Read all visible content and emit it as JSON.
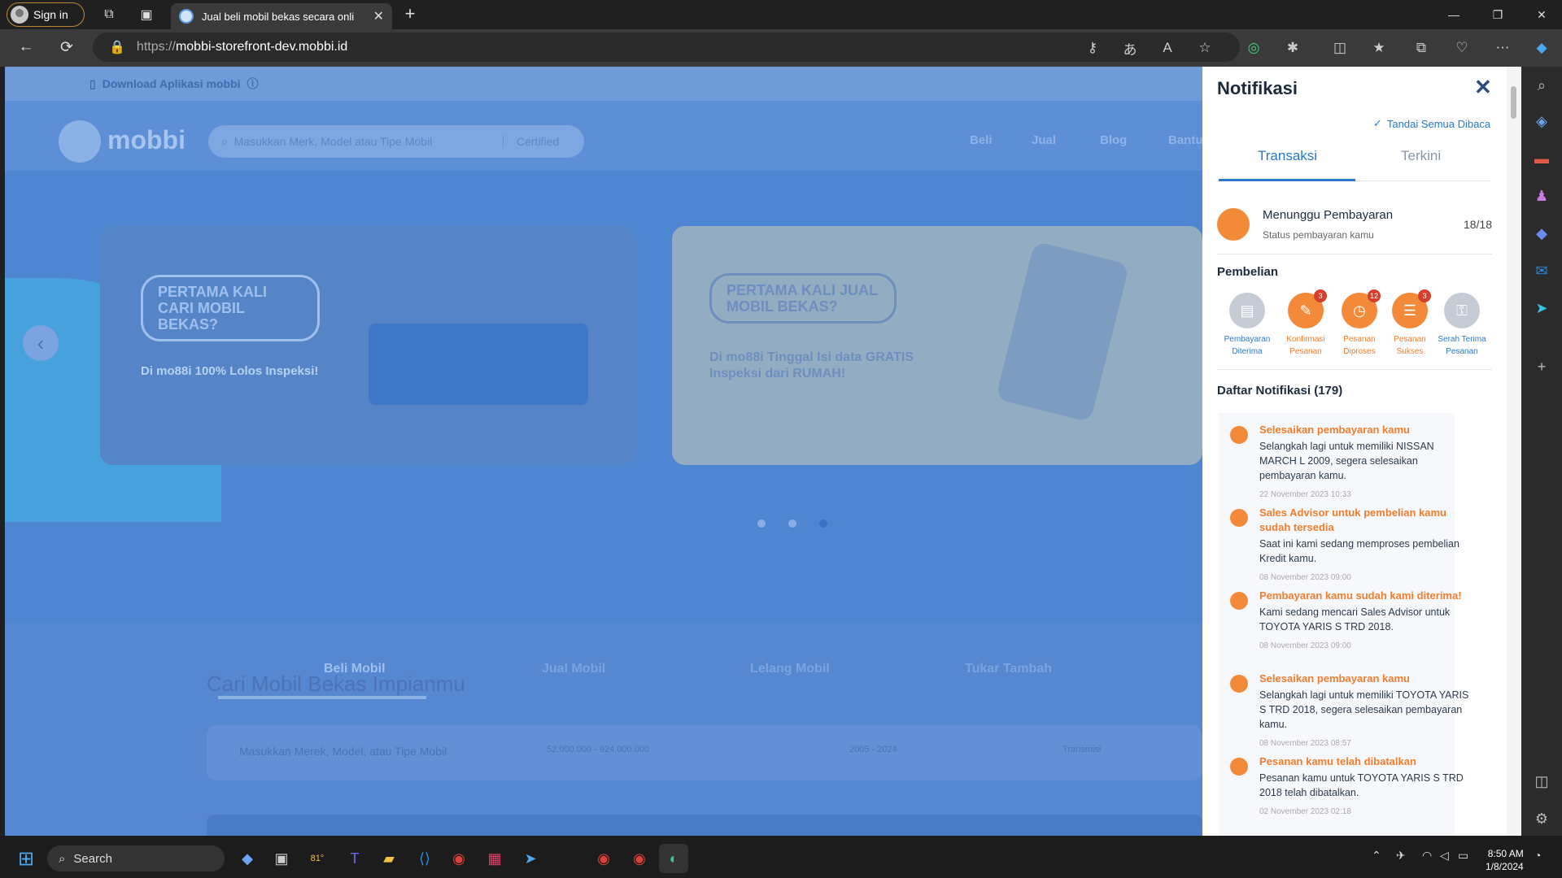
{
  "browser": {
    "signin": "Sign in",
    "tab_title": "Jual beli mobil bekas secara onli",
    "address": {
      "protocol": "https://",
      "host": "mobbi-storefront-dev.mobbi.id"
    }
  },
  "page": {
    "download_bar": "Download Aplikasi mobbi",
    "logo": "mobbi",
    "search_placeholder": "Masukkan Merk, Model atau Tipe Mobil",
    "search_filter": "Certified",
    "nav": [
      "Beli",
      "Jual",
      "Blog",
      "Bantu"
    ],
    "banner1": {
      "title": "PERTAMA KALI CARI MOBIL BEKAS?",
      "sub": "Di mo88i 100% Lolos Inspeksi!"
    },
    "banner2": {
      "title": "PERTAMA KALI JUAL MOBIL BEKAS?",
      "sub": "Di mo88i Tinggal Isi data GRATIS Inspeksi dari RUMAH!"
    },
    "tabs": [
      "Beli Mobil",
      "Jual Mobil",
      "Lelang Mobil",
      "Tukar Tambah"
    ],
    "heading": "Cari Mobil Bekas Impianmu",
    "filters": {
      "keyword": "Masukkan Merek, Model, atau Tipe Mobil",
      "price": "52.000.000 - 924.000.000",
      "year": "2005 - 2024",
      "trans": "Transmisi"
    }
  },
  "notif": {
    "title": "Notifikasi",
    "mark_all": "Tandai Semua Dibaca",
    "tabs": {
      "active": "Transaksi",
      "other": "Terkini"
    },
    "payment": {
      "title": "Menunggu Pembayaran",
      "sub": "Status pembayaran kamu",
      "count": "18/18"
    },
    "purchase_label": "Pembelian",
    "steps": [
      {
        "l1": "Pembayaran",
        "l2": "Diterima",
        "badge": ""
      },
      {
        "l1": "Konfirmasi",
        "l2": "Pesanan",
        "badge": "3"
      },
      {
        "l1": "Pesanan",
        "l2": "Diproses",
        "badge": "12"
      },
      {
        "l1": "Pesanan",
        "l2": "Sukses",
        "badge": "3"
      },
      {
        "l1": "Serah Terima",
        "l2": "Pesanan",
        "badge": ""
      }
    ],
    "list_label": "Daftar Notifikasi (179)",
    "items": [
      {
        "title": "Selesaikan pembayaran kamu",
        "desc": "Selangkah lagi untuk memiliki NISSAN MARCH L 2009, segera selesaikan pembayaran kamu.",
        "time": "22 November 2023 10:33"
      },
      {
        "title": "Sales Advisor untuk pembelian kamu sudah tersedia",
        "desc": "Saat ini kami sedang memproses pembelian Kredit kamu.",
        "time": "08 November 2023 09:00"
      },
      {
        "title": "Pembayaran kamu sudah kami diterima!",
        "desc": "Kami sedang mencari Sales Advisor untuk TOYOTA YARIS S TRD 2018.",
        "time": "08 November 2023 09:00"
      },
      {
        "title": "Selesaikan pembayaran kamu",
        "desc": "Selangkah lagi untuk memiliki TOYOTA YARIS S TRD 2018, segera selesaikan pembayaran kamu.",
        "time": "08 November 2023 08:57"
      },
      {
        "title": "Pesanan kamu telah dibatalkan",
        "desc": "Pesanan kamu untuk TOYOTA YARIS S TRD 2018 telah dibatalkan.",
        "time": "02 November 2023 02:18"
      }
    ]
  },
  "taskbar": {
    "search": "Search",
    "weather": "81°",
    "time": "8:50 AM",
    "date": "1/8/2024"
  }
}
